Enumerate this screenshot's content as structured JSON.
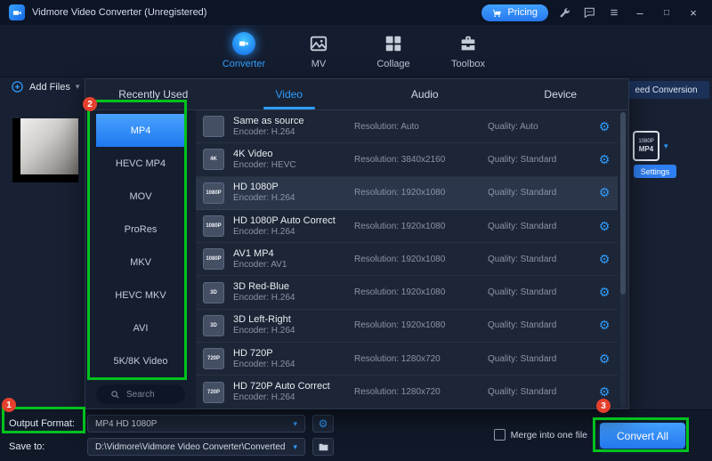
{
  "titlebar": {
    "title": "Vidmore Video Converter (Unregistered)",
    "pricing_label": "Pricing"
  },
  "nav": {
    "tabs": [
      {
        "label": "Converter"
      },
      {
        "label": "MV"
      },
      {
        "label": "Collage"
      },
      {
        "label": "Toolbox"
      }
    ]
  },
  "toolbar": {
    "add_files_label": "Add Files",
    "speed_banner": "eed Conversion"
  },
  "file_area": {
    "format_chip": {
      "line1": "1080P",
      "line2": "MP4"
    },
    "settings_label": "Settings"
  },
  "panel": {
    "tabs": [
      {
        "label": "Recently Used"
      },
      {
        "label": "Video"
      },
      {
        "label": "Audio"
      },
      {
        "label": "Device"
      }
    ],
    "sidebar": [
      {
        "label": "MP4"
      },
      {
        "label": "HEVC MP4"
      },
      {
        "label": "MOV"
      },
      {
        "label": "ProRes"
      },
      {
        "label": "MKV"
      },
      {
        "label": "HEVC MKV"
      },
      {
        "label": "AVI"
      },
      {
        "label": "5K/8K Video"
      }
    ],
    "search_placeholder": "Search",
    "presets": [
      {
        "badge": "",
        "name": "Same as source",
        "encoder": "Encoder: H.264",
        "resolution": "Resolution: Auto",
        "quality": "Quality: Auto"
      },
      {
        "badge": "4K",
        "name": "4K Video",
        "encoder": "Encoder: HEVC",
        "resolution": "Resolution: 3840x2160",
        "quality": "Quality: Standard"
      },
      {
        "badge": "1080P",
        "name": "HD 1080P",
        "encoder": "Encoder: H.264",
        "resolution": "Resolution: 1920x1080",
        "quality": "Quality: Standard"
      },
      {
        "badge": "1080P",
        "name": "HD 1080P Auto Correct",
        "encoder": "Encoder: H.264",
        "resolution": "Resolution: 1920x1080",
        "quality": "Quality: Standard"
      },
      {
        "badge": "1080P",
        "name": "AV1 MP4",
        "encoder": "Encoder: AV1",
        "resolution": "Resolution: 1920x1080",
        "quality": "Quality: Standard"
      },
      {
        "badge": "3D",
        "name": "3D Red-Blue",
        "encoder": "Encoder: H.264",
        "resolution": "Resolution: 1920x1080",
        "quality": "Quality: Standard"
      },
      {
        "badge": "3D",
        "name": "3D Left-Right",
        "encoder": "Encoder: H.264",
        "resolution": "Resolution: 1920x1080",
        "quality": "Quality: Standard"
      },
      {
        "badge": "720P",
        "name": "HD 720P",
        "encoder": "Encoder: H.264",
        "resolution": "Resolution: 1280x720",
        "quality": "Quality: Standard"
      },
      {
        "badge": "720P",
        "name": "HD 720P Auto Correct",
        "encoder": "Encoder: H.264",
        "resolution": "Resolution: 1280x720",
        "quality": "Quality: Standard"
      }
    ]
  },
  "bottom": {
    "output_format_label": "Output Format:",
    "output_format_value": "MP4 HD 1080P",
    "save_to_label": "Save to:",
    "save_to_value": "D:\\Vidmore\\Vidmore Video Converter\\Converted",
    "merge_label": "Merge into one file",
    "convert_all_label": "Convert All"
  },
  "annotations": {
    "step1": "1",
    "step2": "2",
    "step3": "3",
    "highlight_color": "#00c21d",
    "badge_color": "#e5402e"
  }
}
